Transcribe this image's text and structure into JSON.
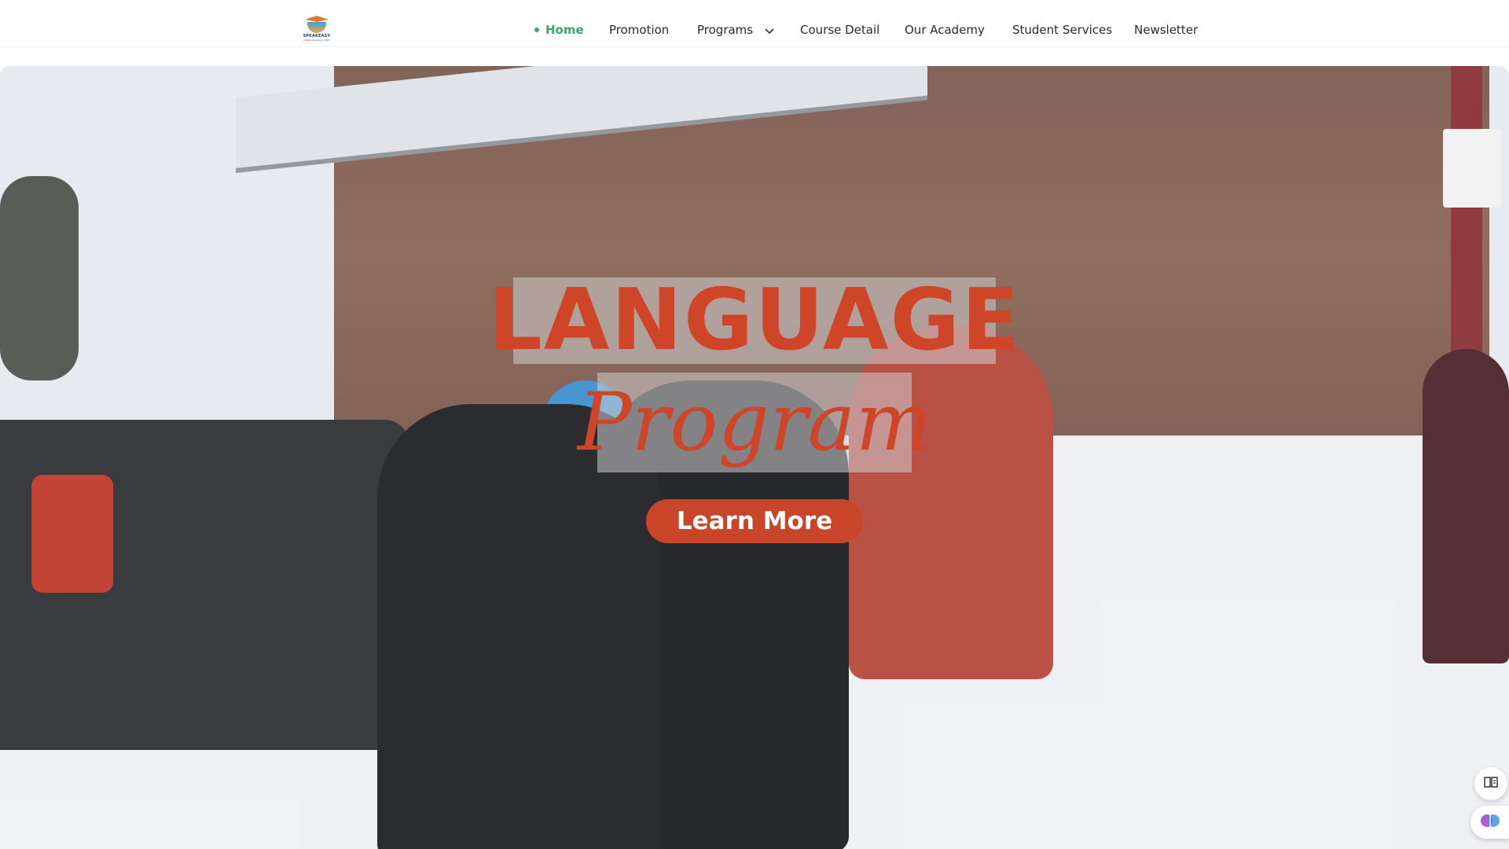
{
  "brand": {
    "logo_name": "SPEAKEASY",
    "logo_tagline": "Global Academy 2019"
  },
  "nav": {
    "items": [
      {
        "label": "Home",
        "active": true
      },
      {
        "label": "Promotion"
      },
      {
        "label": "Programs",
        "has_dropdown": true
      },
      {
        "label": "Course Detail"
      },
      {
        "label": "Our Academy"
      },
      {
        "label": "Student Services"
      },
      {
        "label": "Newsletter"
      }
    ],
    "active_color": "#3aa86a"
  },
  "hero": {
    "title": "LANGUAGE",
    "subtitle": "Program",
    "cta_label": "Learn More",
    "accent_color": "#cf4527"
  },
  "floating": {
    "reader_icon": "book-open-icon",
    "ai_icon": "brain-icon"
  }
}
